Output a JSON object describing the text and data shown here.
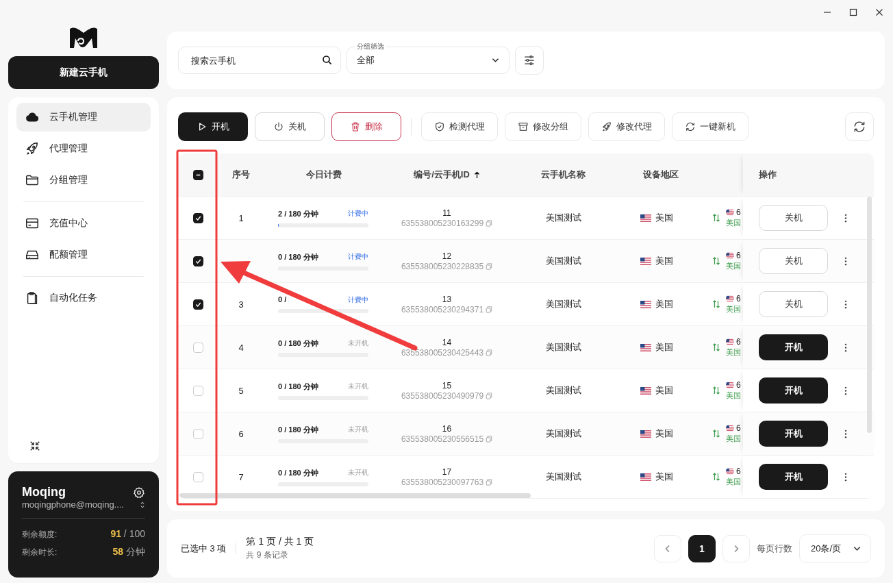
{
  "sidebar": {
    "new_button": "新建云手机",
    "nav_groups": [
      [
        {
          "label": "云手机管理",
          "selected": true
        },
        {
          "label": "代理管理",
          "selected": false
        },
        {
          "label": "分组管理",
          "selected": false
        }
      ],
      [
        {
          "label": "充值中心",
          "selected": false
        },
        {
          "label": "配额管理",
          "selected": false
        }
      ],
      [
        {
          "label": "自动化任务",
          "selected": false
        }
      ]
    ]
  },
  "user": {
    "name": "Moqing",
    "email": "moqingphone@moqing....",
    "quota_label": "剩余额度:",
    "quota_value": "91",
    "quota_total": "/ 100",
    "time_label": "剩余时长:",
    "time_value": "58",
    "time_unit": "分钟"
  },
  "search": {
    "placeholder": "搜索云手机"
  },
  "group_filter": {
    "label": "分组筛选",
    "value": "全部"
  },
  "toolbar": [
    {
      "label": "开机",
      "kind": "primary"
    },
    {
      "label": "关机",
      "kind": "outline"
    },
    {
      "label": "删除",
      "kind": "danger"
    },
    {
      "label": "检测代理",
      "kind": "secondary"
    },
    {
      "label": "修改分组",
      "kind": "secondary"
    },
    {
      "label": "修改代理",
      "kind": "secondary"
    },
    {
      "label": "一键新机",
      "kind": "secondary"
    }
  ],
  "table": {
    "select_all": {
      "indeterminate": true
    },
    "columns": [
      {
        "label": "序号"
      },
      {
        "label": "今日计费"
      },
      {
        "label": "编号/云手机ID",
        "sorted_ascending": true
      },
      {
        "label": "云手机名称"
      },
      {
        "label": "设备地区"
      },
      {
        "label": "操作"
      }
    ],
    "rows": [
      {
        "selected": true,
        "index": "1",
        "usage": "2 / 180 分钟",
        "level": 0.011,
        "status": "计费中",
        "running": true,
        "number": "11",
        "device_id": "635538005230163299",
        "name": "美国测试",
        "region": "美国",
        "proxy_ip": "6",
        "proxy_region": "美国",
        "action": "关机"
      },
      {
        "selected": true,
        "usage": "0 / 180 分钟",
        "level": 0,
        "status": "计费中",
        "running": true,
        "number": "12",
        "device_id": "635538005230228835",
        "name": "美国测试",
        "region": "美国",
        "proxy_ip": "6",
        "proxy_region": "美国",
        "action": "关机"
      },
      {
        "selected": true,
        "index": "3",
        "usage": "0 /",
        "level": 0,
        "status": "计费中",
        "running": true,
        "number": "13",
        "device_id": "635538005230294371",
        "name": "美国测试",
        "region": "美国",
        "proxy_ip": "6",
        "proxy_region": "美国",
        "action": "关机"
      },
      {
        "selected": false,
        "index": "4",
        "usage": "0 / 180 分钟",
        "level": 0,
        "status": "未开机",
        "running": false,
        "number": "14",
        "device_id": "635538005230425443",
        "name": "美国测试",
        "region": "美国",
        "proxy_ip": "6",
        "proxy_region": "美国",
        "action": "开机"
      },
      {
        "selected": false,
        "index": "5",
        "usage": "0 / 180 分钟",
        "level": 0,
        "status": "未开机",
        "running": false,
        "number": "15",
        "device_id": "635538005230490979",
        "name": "美国测试",
        "region": "美国",
        "proxy_ip": "6",
        "proxy_region": "美国",
        "action": "开机"
      },
      {
        "selected": false,
        "index": "6",
        "usage": "0 / 180 分钟",
        "level": 0,
        "status": "未开机",
        "running": false,
        "number": "16",
        "device_id": "635538005230556515",
        "name": "美国测试",
        "region": "美国",
        "proxy_ip": "6",
        "proxy_region": "美国",
        "action": "开机"
      },
      {
        "selected": false,
        "index": "7",
        "usage": "0 / 180 分钟",
        "level": 0,
        "status": "未开机",
        "running": false,
        "number": "17",
        "device_id": "635538005230097763",
        "name": "美国测试",
        "region": "美国",
        "proxy_ip": "6",
        "proxy_region": "美国",
        "action": "开机"
      }
    ]
  },
  "footer": {
    "selected_count": "已选中 3 项",
    "page_info": "第 1 页 / 共 1 页",
    "total": "共 9 条记录",
    "pages": [
      {
        "label": "1",
        "selected": true
      }
    ],
    "rows_label": "每页行数",
    "page_size": "20条/页"
  }
}
